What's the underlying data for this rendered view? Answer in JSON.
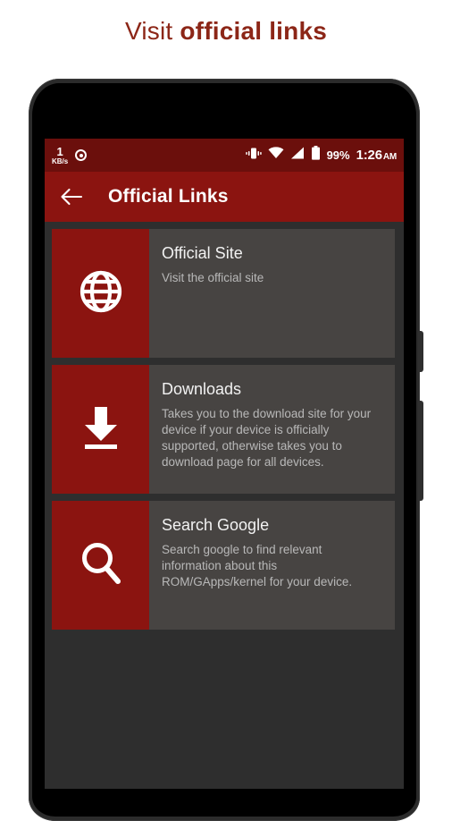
{
  "promo": {
    "text_light": "Visit ",
    "text_bold": "official links",
    "color": "#8C2617"
  },
  "device": {
    "earpiece_icon": "earpiece-speaker-icon",
    "camera_icon": "front-camera-icon",
    "buttons": [
      "volume-rocker",
      "power-button"
    ]
  },
  "status_bar": {
    "background": "#6B0F0C",
    "network_speed_value": "1",
    "network_speed_unit": "KB/s",
    "record_icon": "record-dot-icon",
    "vibrate_icon": "vibrate-icon",
    "wifi_icon": "wifi-icon",
    "signal_icon": "cell-signal-icon",
    "battery_icon": "battery-full-icon",
    "battery_percent": "99%",
    "clock": "1:26",
    "clock_ampm": "AM"
  },
  "app_bar": {
    "background": "#8B1410",
    "back_icon": "arrow-back-icon",
    "title": "Official Links"
  },
  "cards": [
    {
      "icon": "globe-icon",
      "title": "Official Site",
      "description": "Visit the official site"
    },
    {
      "icon": "download-icon",
      "title": "Downloads",
      "description": "Takes you to the download site for your device if your device is officially supported, otherwise takes you to download page for all devices."
    },
    {
      "icon": "search-icon",
      "title": "Search Google",
      "description": "Search google to find relevant information about this ROM/GApps/kernel for your device."
    }
  ],
  "theme": {
    "accent_red": "#8B1410",
    "status_red": "#6B0F0C",
    "card_bg": "#474442",
    "screen_bg": "#2E2E2E",
    "title_text": "#F2F2F2",
    "desc_text": "#B8B8B8"
  }
}
